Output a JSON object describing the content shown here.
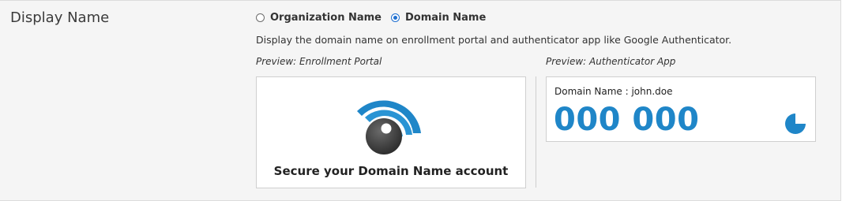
{
  "section": {
    "label": "Display Name"
  },
  "display_name_options": [
    {
      "label": "Organization Name",
      "selected": false
    },
    {
      "label": "Domain Name",
      "selected": true
    }
  ],
  "helper_text": "Display the domain name on enrollment portal and authenticator app like Google Authenticator.",
  "enrollment_preview": {
    "label": "Preview: Enrollment Portal",
    "title": "Secure your Domain Name account",
    "logo_icon": "eye-signal-icon"
  },
  "authenticator_preview": {
    "label": "Preview: Authenticator App",
    "account": "Domain Name : john.doe",
    "code": "000 000",
    "timer_icon": "countdown-timer-icon",
    "timer_remaining_fraction": 0.75
  },
  "colors": {
    "accent": "#1f86c8",
    "radio_selected": "#1f6fd0",
    "panel_bg": "#f5f5f5"
  }
}
